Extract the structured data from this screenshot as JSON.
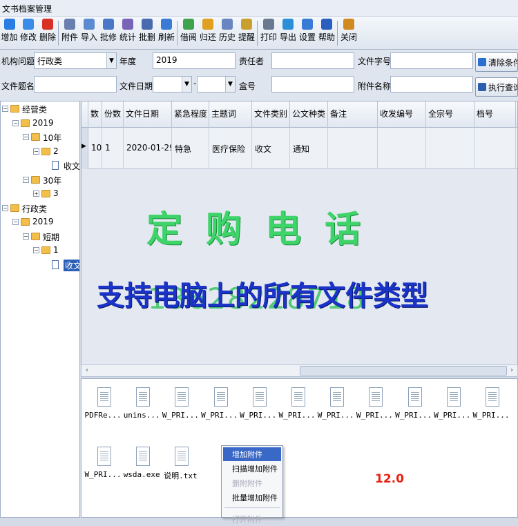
{
  "window": {
    "title": "文书档案管理"
  },
  "toolbar": {
    "groups": [
      [
        {
          "label": "增加",
          "icon": "plus-icon",
          "color": "#2a7de1"
        },
        {
          "label": "修改",
          "icon": "pencil-icon",
          "color": "#3b8be8"
        },
        {
          "label": "删除",
          "icon": "close-icon",
          "color": "#d93025"
        }
      ],
      [
        {
          "label": "附件",
          "icon": "paperclip-icon",
          "color": "#6a7fb0"
        },
        {
          "label": "导入",
          "icon": "import-icon",
          "color": "#5b8ad0"
        },
        {
          "label": "批修",
          "icon": "batch-edit-icon",
          "color": "#4a78c8"
        },
        {
          "label": "统计",
          "icon": "stats-icon",
          "color": "#7a64b8"
        },
        {
          "label": "批删",
          "icon": "batch-delete-icon",
          "color": "#4a6ab0"
        },
        {
          "label": "刷新",
          "icon": "refresh-icon",
          "color": "#3a7bd5"
        }
      ],
      [
        {
          "label": "借阅",
          "icon": "borrow-icon",
          "color": "#3fa34d"
        },
        {
          "label": "归还",
          "icon": "return-icon",
          "color": "#e0a020"
        },
        {
          "label": "历史",
          "icon": "history-icon",
          "color": "#6a86c0"
        },
        {
          "label": "提醒",
          "icon": "reminder-icon",
          "color": "#c9a030"
        }
      ],
      [
        {
          "label": "打印",
          "icon": "print-icon",
          "color": "#6a7a90"
        },
        {
          "label": "导出",
          "icon": "export-icon",
          "color": "#2d8fd8"
        },
        {
          "label": "设置",
          "icon": "settings-icon",
          "color": "#3a7bd5"
        },
        {
          "label": "帮助",
          "icon": "help-icon",
          "color": "#2a5fc0"
        }
      ],
      [
        {
          "label": "关闭",
          "icon": "exit-icon",
          "color": "#d08a20"
        }
      ]
    ]
  },
  "filters": {
    "org_label": "机构问题",
    "org_value": "行政类",
    "year_label": "年度",
    "year_value": "2019",
    "owner_label": "责任者",
    "owner_value": "",
    "docno_label": "文件字号",
    "docno_value": "",
    "clear_button": "清除条件",
    "title_label": "文件题名",
    "title_value": "",
    "date_label": "文件日期",
    "date_sep": "-",
    "box_label": "盒号",
    "box_value": "",
    "attach_label": "附件名称",
    "attach_value": "",
    "run_button": "执行查询"
  },
  "tree": {
    "nodes": [
      {
        "label": "经营类",
        "depth": 0,
        "type": "folder",
        "toggle": "-"
      },
      {
        "label": "2019",
        "depth": 1,
        "type": "folder",
        "toggle": "-"
      },
      {
        "label": "10年",
        "depth": 2,
        "type": "folder",
        "toggle": "-"
      },
      {
        "label": "2",
        "depth": 3,
        "type": "folder",
        "toggle": "-"
      },
      {
        "label": "收文",
        "depth": 4,
        "type": "doc",
        "toggle": ""
      },
      {
        "label": "30年",
        "depth": 2,
        "type": "folder",
        "toggle": "-"
      },
      {
        "label": "3",
        "depth": 3,
        "type": "folder",
        "toggle": "+"
      },
      {
        "label": "行政类",
        "depth": 0,
        "type": "folder",
        "toggle": "-"
      },
      {
        "label": "2019",
        "depth": 1,
        "type": "folder",
        "toggle": "-"
      },
      {
        "label": "短期",
        "depth": 2,
        "type": "folder",
        "toggle": "-"
      },
      {
        "label": "1",
        "depth": 3,
        "type": "folder",
        "toggle": "-"
      },
      {
        "label": "收文",
        "depth": 4,
        "type": "doc",
        "toggle": "",
        "selected": true
      }
    ]
  },
  "grid": {
    "columns": [
      "数",
      "份数",
      "文件日期",
      "紧急程度",
      "主题词",
      "文件类别",
      "公文种类",
      "备注",
      "收发编号",
      "全宗号",
      "档号"
    ],
    "rows": [
      [
        "10",
        "1",
        "2020-01-29",
        "特急",
        "医疗保险",
        "收文",
        "通知",
        "",
        "",
        "",
        ""
      ]
    ]
  },
  "attachments": {
    "files": [
      "PDFRe...",
      "unins...",
      "W_PRI...",
      "W_PRI...",
      "W_PRI...",
      "W_PRI...",
      "W_PRI...",
      "W_PRI...",
      "W_PRI...",
      "W_PRI...",
      "W_PRI...",
      "W_PRI...",
      "wsda.exe",
      "说明.txt"
    ]
  },
  "context_menu": {
    "items": [
      {
        "label": "增加附件",
        "state": "highlight"
      },
      {
        "label": "扫描增加附件",
        "state": "normal"
      },
      {
        "label": "删附附件",
        "state": "disabled"
      },
      {
        "label": "批量增加附件",
        "state": "normal"
      },
      {
        "label": "打开附件",
        "state": "disabled"
      }
    ]
  },
  "overlay": {
    "title": "定购电话",
    "subtitle": "支持电脑上的所有文件类型",
    "phone": "13628228718",
    "version": "12.0"
  }
}
